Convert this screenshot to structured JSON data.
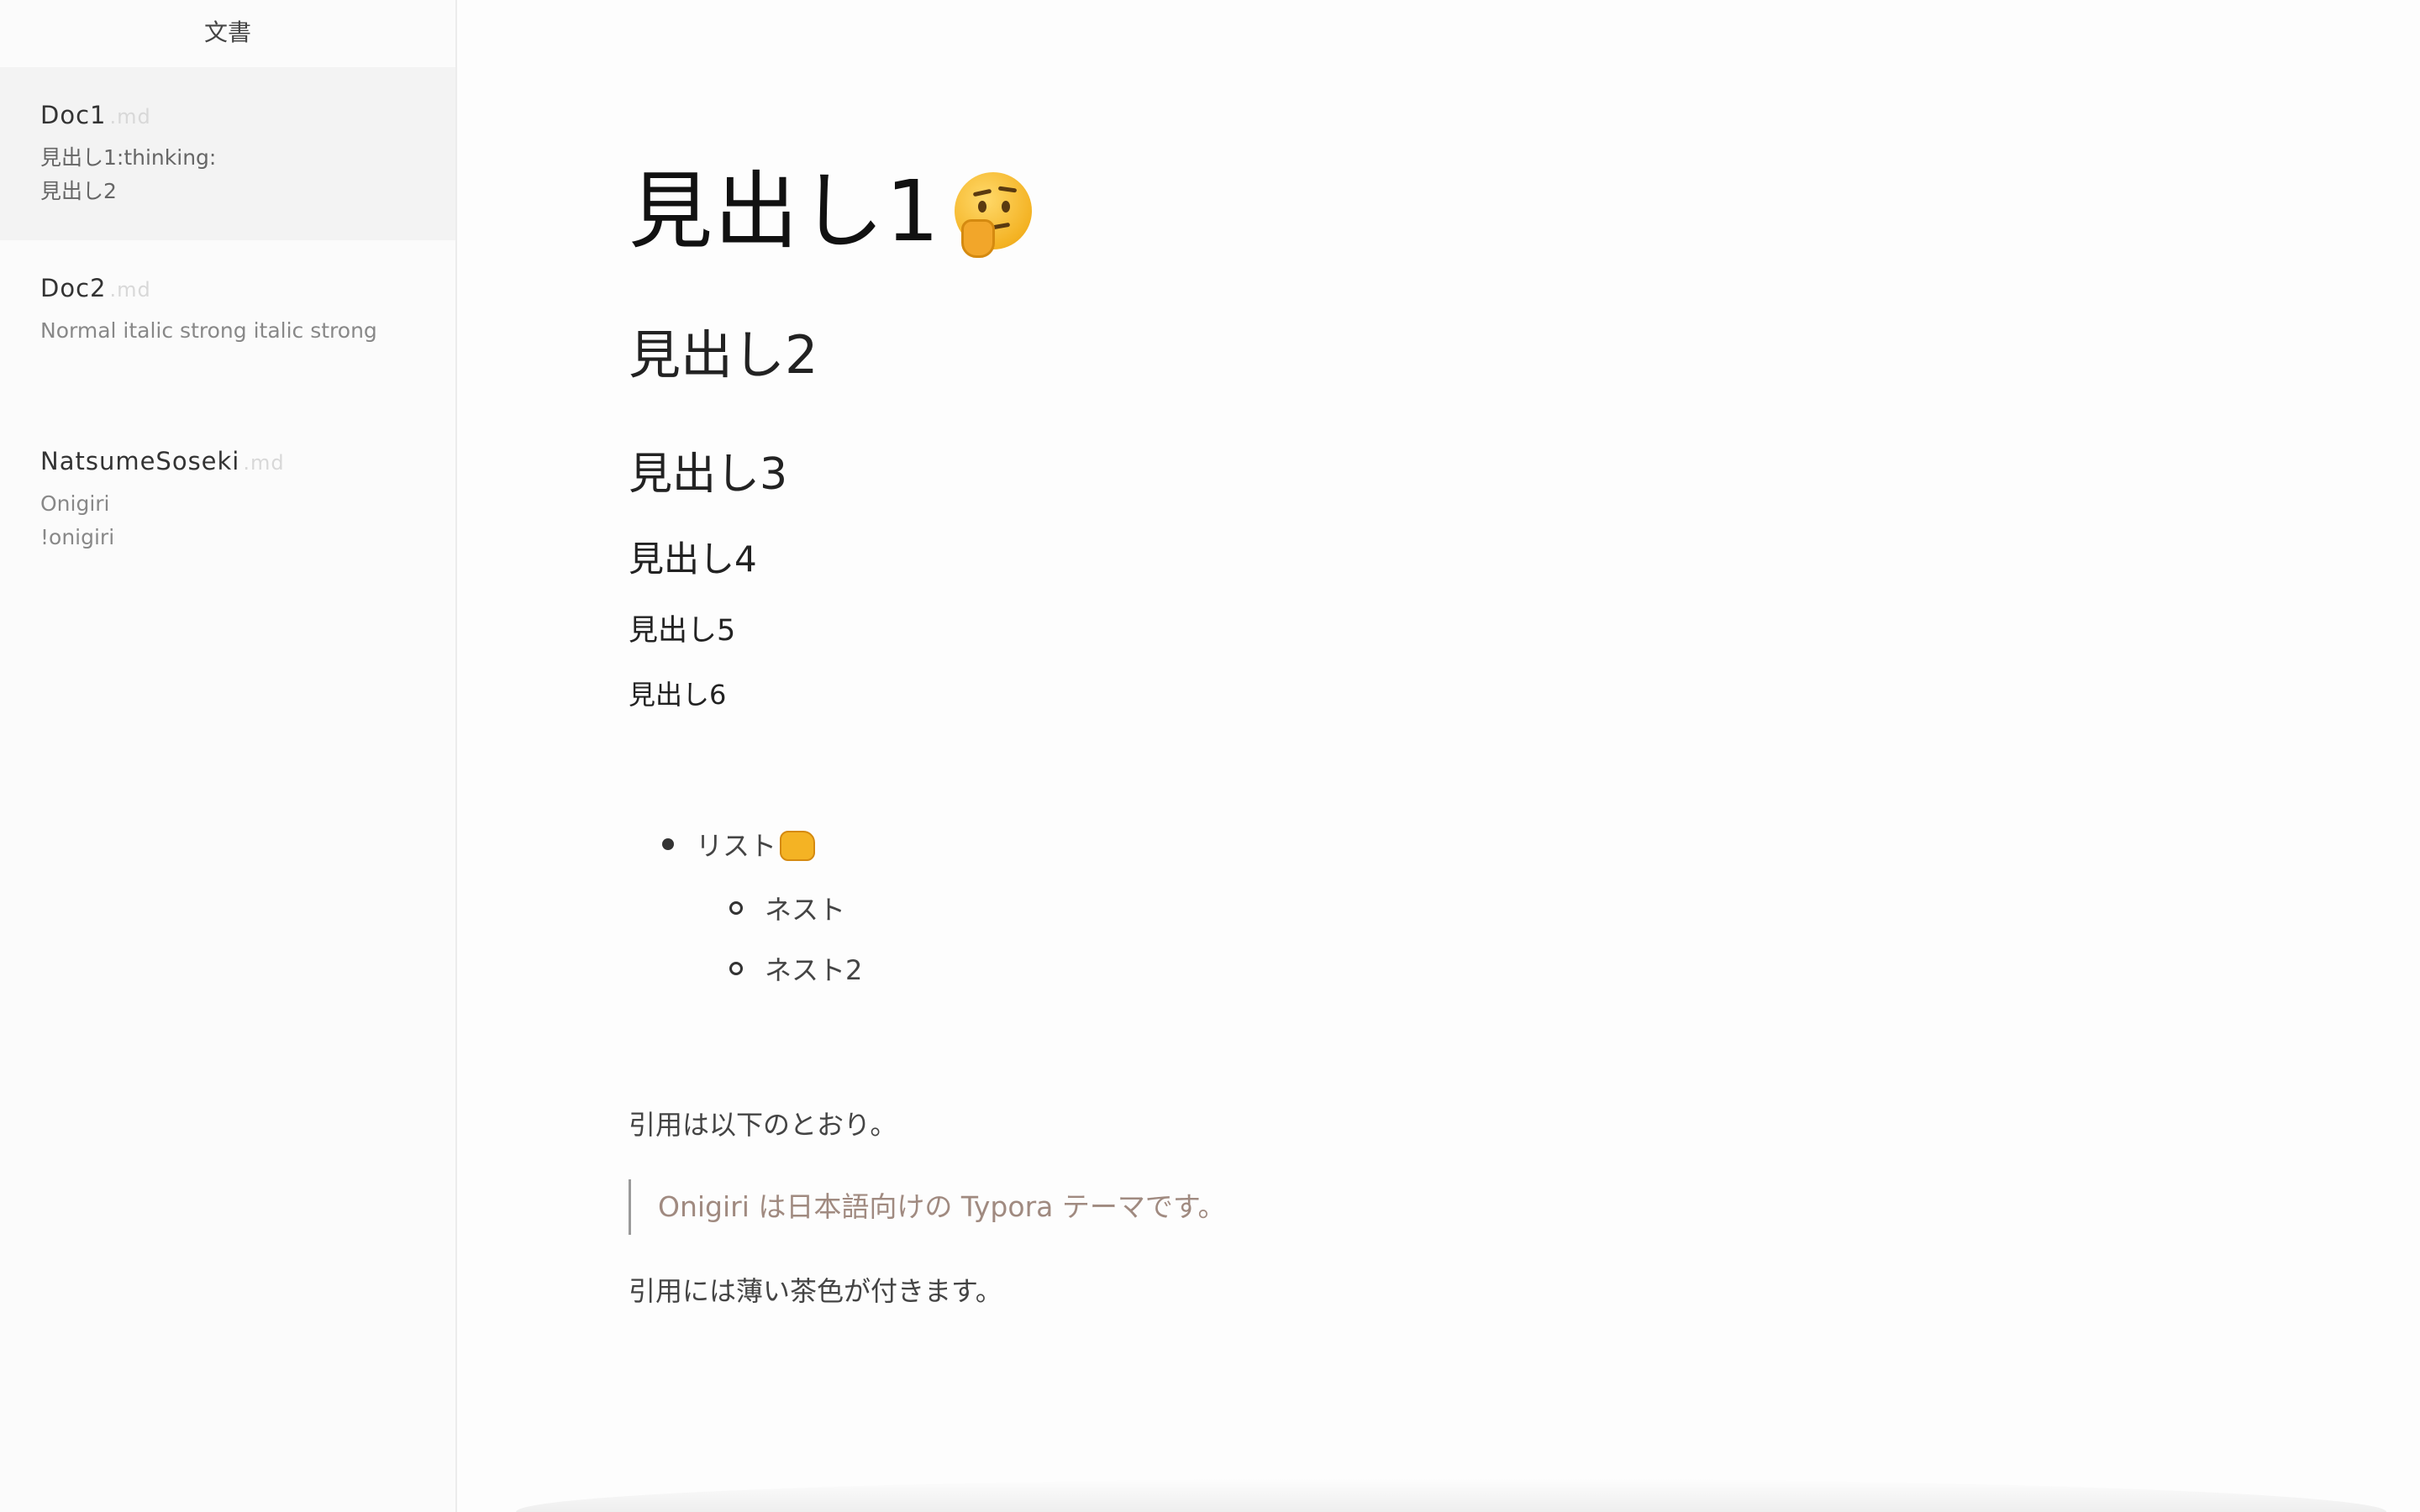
{
  "sidebar": {
    "title": "文書",
    "docs": [
      {
        "name": "Doc1",
        "ext": ".md",
        "preview": "見出し1:thinking:\n見出し2"
      },
      {
        "name": "Doc2",
        "ext": ".md",
        "preview": "Normal italic strong italic strong"
      },
      {
        "name": "NatsumeSoseki",
        "ext": ".md",
        "preview": "Onigiri\n!onigiri"
      }
    ]
  },
  "document": {
    "h1": "見出し1",
    "h2": "見出し2",
    "h3": "見出し3",
    "h4": "見出し4",
    "h5": "見出し5",
    "h6": "見出し6",
    "list": {
      "item": "リスト",
      "nested": [
        "ネスト",
        "ネスト2"
      ]
    },
    "paragraph1": "引用は以下のとおり。",
    "blockquote": "Onigiri は日本語向けの Typora テーマです。",
    "paragraph2": "引用には薄い茶色が付きます。"
  },
  "icons": {
    "h1_emoji": "thinking-face-icon",
    "list_emoji": "fist-bump-icon"
  },
  "colors": {
    "blockquote_text": "#a08a80",
    "active_item_bg": "#f3f3f3"
  }
}
